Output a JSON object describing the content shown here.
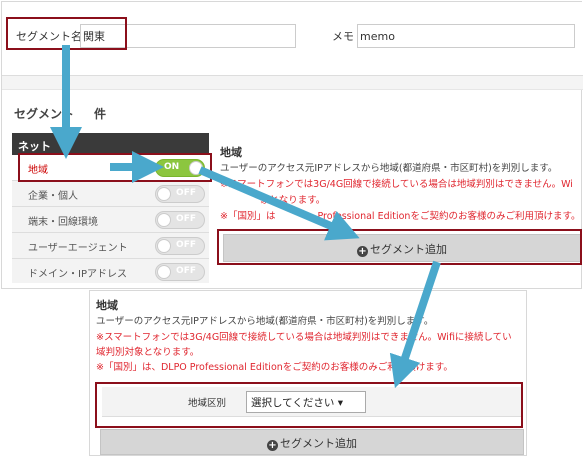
{
  "form": {
    "segment_name_label": "セグメント名",
    "segment_name_value": "関東",
    "memo_label": "メモ",
    "memo_value": "memo"
  },
  "conditions": {
    "title_visible": "セグメント",
    "title_tail": "件"
  },
  "sidebar": {
    "header": "ネット",
    "items": [
      {
        "label": "地域",
        "toggle": "ON"
      },
      {
        "label": "企業・個人",
        "toggle": "OFF"
      },
      {
        "label": "端末・回線環境",
        "toggle": "OFF"
      },
      {
        "label": "ユーザーエージェント",
        "toggle": "OFF"
      },
      {
        "label": "ドメイン・IPアドレス",
        "toggle": "OFF"
      }
    ]
  },
  "detail_top": {
    "title": "地域",
    "desc": "ユーザーのアクセス元IPアドレスから地域(都道府県・市区町村)を判別します。",
    "warn1a": "※スマートフォンでは3G/4G回線で接続している場合は地域判別はできません。Wi",
    "warn1b": "象となります。",
    "warn2a": "※「国別」は",
    "warn2b": "Professional Editionをご契約のお客様のみご利用頂けます。",
    "add_label": "セグメント追加"
  },
  "detail_bottom": {
    "title": "地域",
    "desc": "ユーザーのアクセス元IPアドレスから地域(都道府県・市区町村)を判別します。",
    "warn1": "※スマートフォンでは3G/4G回線で接続している場合は地域判別はできません。Wifiに接続してい",
    "warn2": "域判別対象となります。",
    "warn3": "※「国別」は、DLPO Professional Editionをご契約のお客様のみご利用頂けます。",
    "region_label": "地域区別",
    "region_select": "選択してください ▾",
    "add_label": "セグメント追加"
  },
  "colors": {
    "highlight": "#8b0f1b",
    "arrow": "#4aa8cc",
    "toggle_on": "#8cc63f",
    "warning_red": "#e0262f"
  }
}
